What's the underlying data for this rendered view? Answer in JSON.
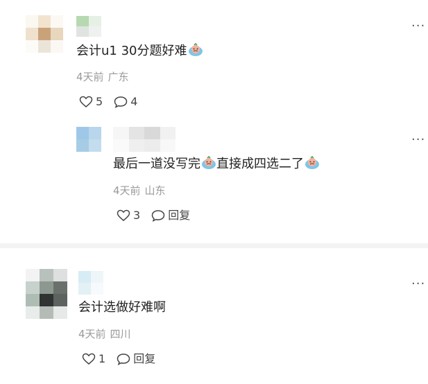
{
  "comments": [
    {
      "text": "会计u1 30分题好难",
      "emoji": "crying-face",
      "time": "4天前",
      "location": "广东",
      "likes": "5",
      "replies": "4",
      "reply": {
        "text_part1": "最后一道没写完",
        "text_part2": "直接成四选二了",
        "time": "4天前",
        "location": "山东",
        "likes": "3",
        "reply_label": "回复"
      }
    },
    {
      "text": "会计选做好难啊",
      "time": "4天前",
      "location": "四川",
      "likes": "1",
      "reply_label": "回复"
    }
  ],
  "more_label": "···"
}
